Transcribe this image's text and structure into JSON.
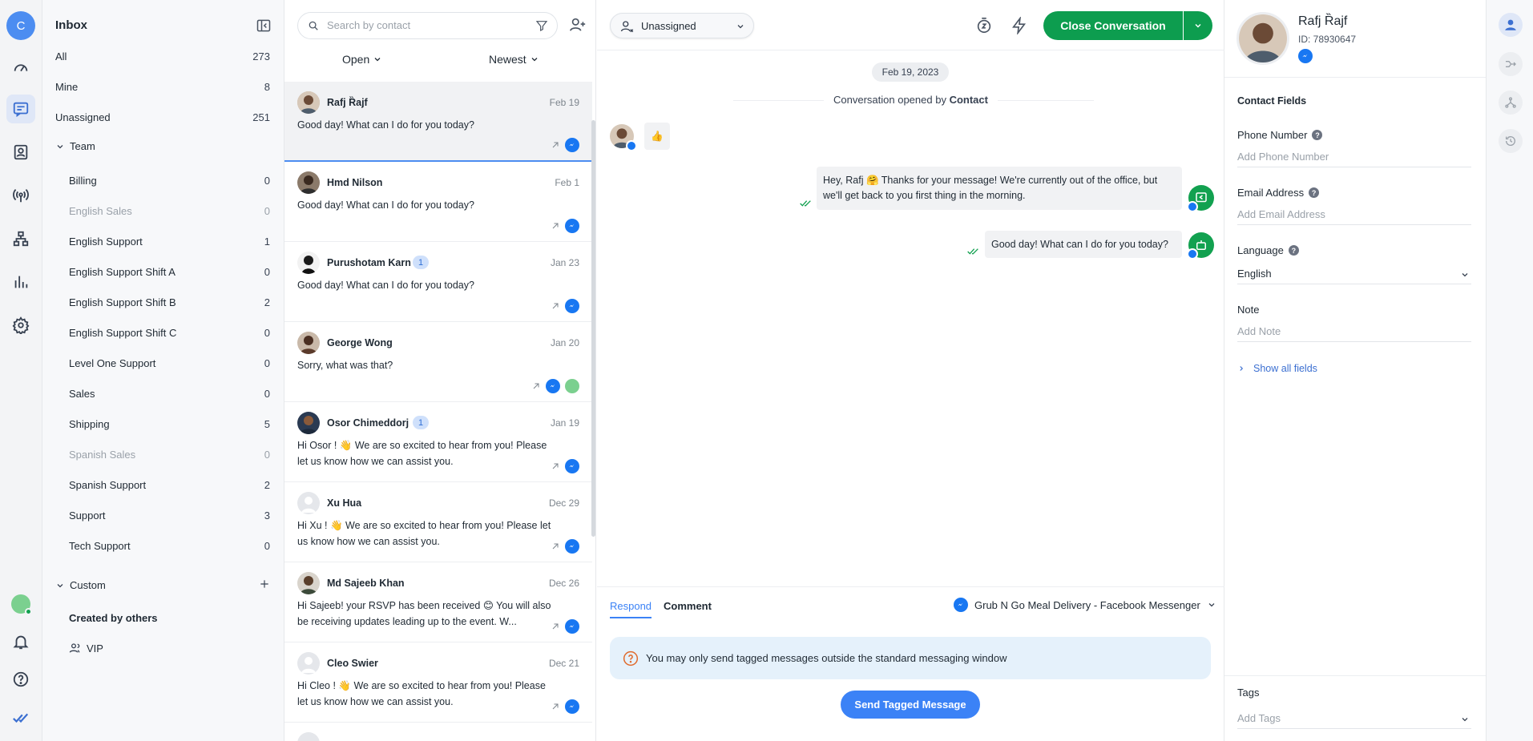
{
  "rail": {
    "avatar_initial": "C",
    "icons": [
      "dashboard-icon",
      "conversations-icon",
      "contacts-icon",
      "broadcast-icon",
      "workflows-icon",
      "reports-icon",
      "settings-icon"
    ],
    "bottom_icons": [
      "user-status-avatar",
      "bell-icon",
      "help-icon",
      "brand-check-icon"
    ]
  },
  "inbox": {
    "title": "Inbox",
    "items": [
      {
        "label": "All",
        "count": "273"
      },
      {
        "label": "Mine",
        "count": "8"
      },
      {
        "label": "Unassigned",
        "count": "251"
      }
    ],
    "team_label": "Team",
    "teams": [
      {
        "label": "Billing",
        "count": "0"
      },
      {
        "label": "English Sales",
        "count": "0"
      },
      {
        "label": "English Support",
        "count": "1"
      },
      {
        "label": "English Support Shift A",
        "count": "0"
      },
      {
        "label": "English Support Shift B",
        "count": "2"
      },
      {
        "label": "English Support Shift C",
        "count": "0"
      },
      {
        "label": "Level One Support",
        "count": "0"
      },
      {
        "label": "Sales",
        "count": "0"
      },
      {
        "label": "Shipping",
        "count": "5"
      },
      {
        "label": "Spanish Sales",
        "count": "0"
      },
      {
        "label": "Spanish Support",
        "count": "2"
      },
      {
        "label": "Support",
        "count": "3"
      },
      {
        "label": "Tech Support",
        "count": "0"
      }
    ],
    "custom_label": "Custom",
    "created_by_others": "Created by others",
    "vip": "VIP"
  },
  "list": {
    "search_placeholder": "Search by contact",
    "status_filter": "Open",
    "sort_filter": "Newest",
    "conversations": [
      {
        "name": "Rafj Ȑajf",
        "date": "Feb 19",
        "message": "Good day! What can I do for you today?",
        "badge": ""
      },
      {
        "name": "Hmd Nilson",
        "date": "Feb 1",
        "message": "Good day! What can I do for you today?",
        "badge": ""
      },
      {
        "name": "Purushotam Karn",
        "date": "Jan 23",
        "message": "Good day! What can I do for you today?",
        "badge": "1"
      },
      {
        "name": "George Wong",
        "date": "Jan 20",
        "message": "Sorry, what was that?",
        "badge": ""
      },
      {
        "name": "Osor Chimeddorj",
        "date": "Jan 19",
        "message": "Hi Osor ! 👋 We are so excited to hear from you! Please let us know how we can assist you.",
        "badge": "1"
      },
      {
        "name": "Xu Hua",
        "date": "Dec 29",
        "message": "Hi Xu ! 👋 We are so excited to hear from you! Please let us know how we can assist you.",
        "badge": ""
      },
      {
        "name": "Md Sajeeb Khan",
        "date": "Dec 26",
        "message": "Hi Sajeeb! your RSVP has been received 😊 You will also be receiving updates leading up to the event. W...",
        "badge": ""
      },
      {
        "name": "Cleo Swier",
        "date": "Dec 21",
        "message": "Hi Cleo ! 👋 We are so excited to hear from you! Please let us know how we can assist you.",
        "badge": ""
      }
    ]
  },
  "chat": {
    "assignee": "Unassigned",
    "close_label": "Close Conversation",
    "date_pill": "Feb 19, 2023",
    "opened_prefix": "Conversation opened by",
    "opened_by": "Contact",
    "incoming_emoji": "👍",
    "msg1": "Hey, Rafj 🤗 Thanks for your message! We're currently out of the office, but we'll get back to you first thing in the morning.",
    "msg2": "Good day! What can I do for you today?",
    "tab_respond": "Respond",
    "tab_comment": "Comment",
    "channel": "Grub N Go Meal Delivery - Facebook Messenger",
    "warning": "You may only send tagged messages outside the standard messaging window",
    "send_tagged": "Send Tagged Message"
  },
  "contact": {
    "name": "Rafj Ȑajf",
    "id": "ID: 78930647",
    "fields_title": "Contact Fields",
    "phone_label": "Phone Number",
    "phone_placeholder": "Add Phone Number",
    "email_label": "Email Address",
    "email_placeholder": "Add Email Address",
    "language_label": "Language",
    "language_value": "English",
    "note_label": "Note",
    "note_placeholder": "Add Note",
    "show_all": "Show all fields",
    "tags_label": "Tags",
    "tags_placeholder": "Add Tags"
  },
  "colors": {
    "accent": "#4c8df1",
    "green": "#0d9d4f",
    "messenger": "#1877f2"
  }
}
